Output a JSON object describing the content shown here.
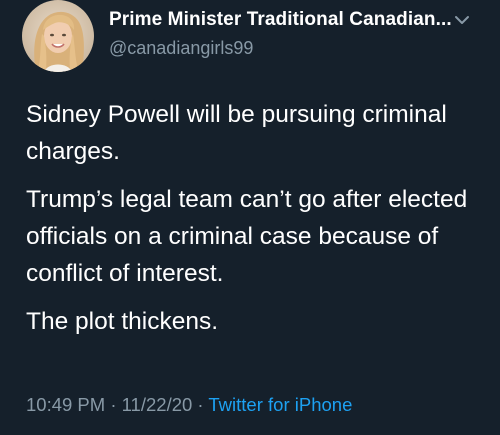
{
  "tweet": {
    "author_name": "Prime Minister Traditional Canadian...",
    "handle": "@canadiangirls99",
    "paragraphs": [
      "Sidney Powell will  be pursuing criminal charges.",
      "Trump’s legal team can’t go after elected officials on a criminal case because of conflict of interest.",
      "The plot thickens."
    ],
    "time": "10:49 PM",
    "separator": "·",
    "date": "11/22/20",
    "source": "Twitter for iPhone",
    "icons": {
      "menu": "chevron-down-icon",
      "avatar": "profile-photo"
    }
  },
  "colors": {
    "background": "#15202b",
    "text": "#ffffff",
    "secondary_text": "#8899a6",
    "link": "#1da1f2"
  }
}
